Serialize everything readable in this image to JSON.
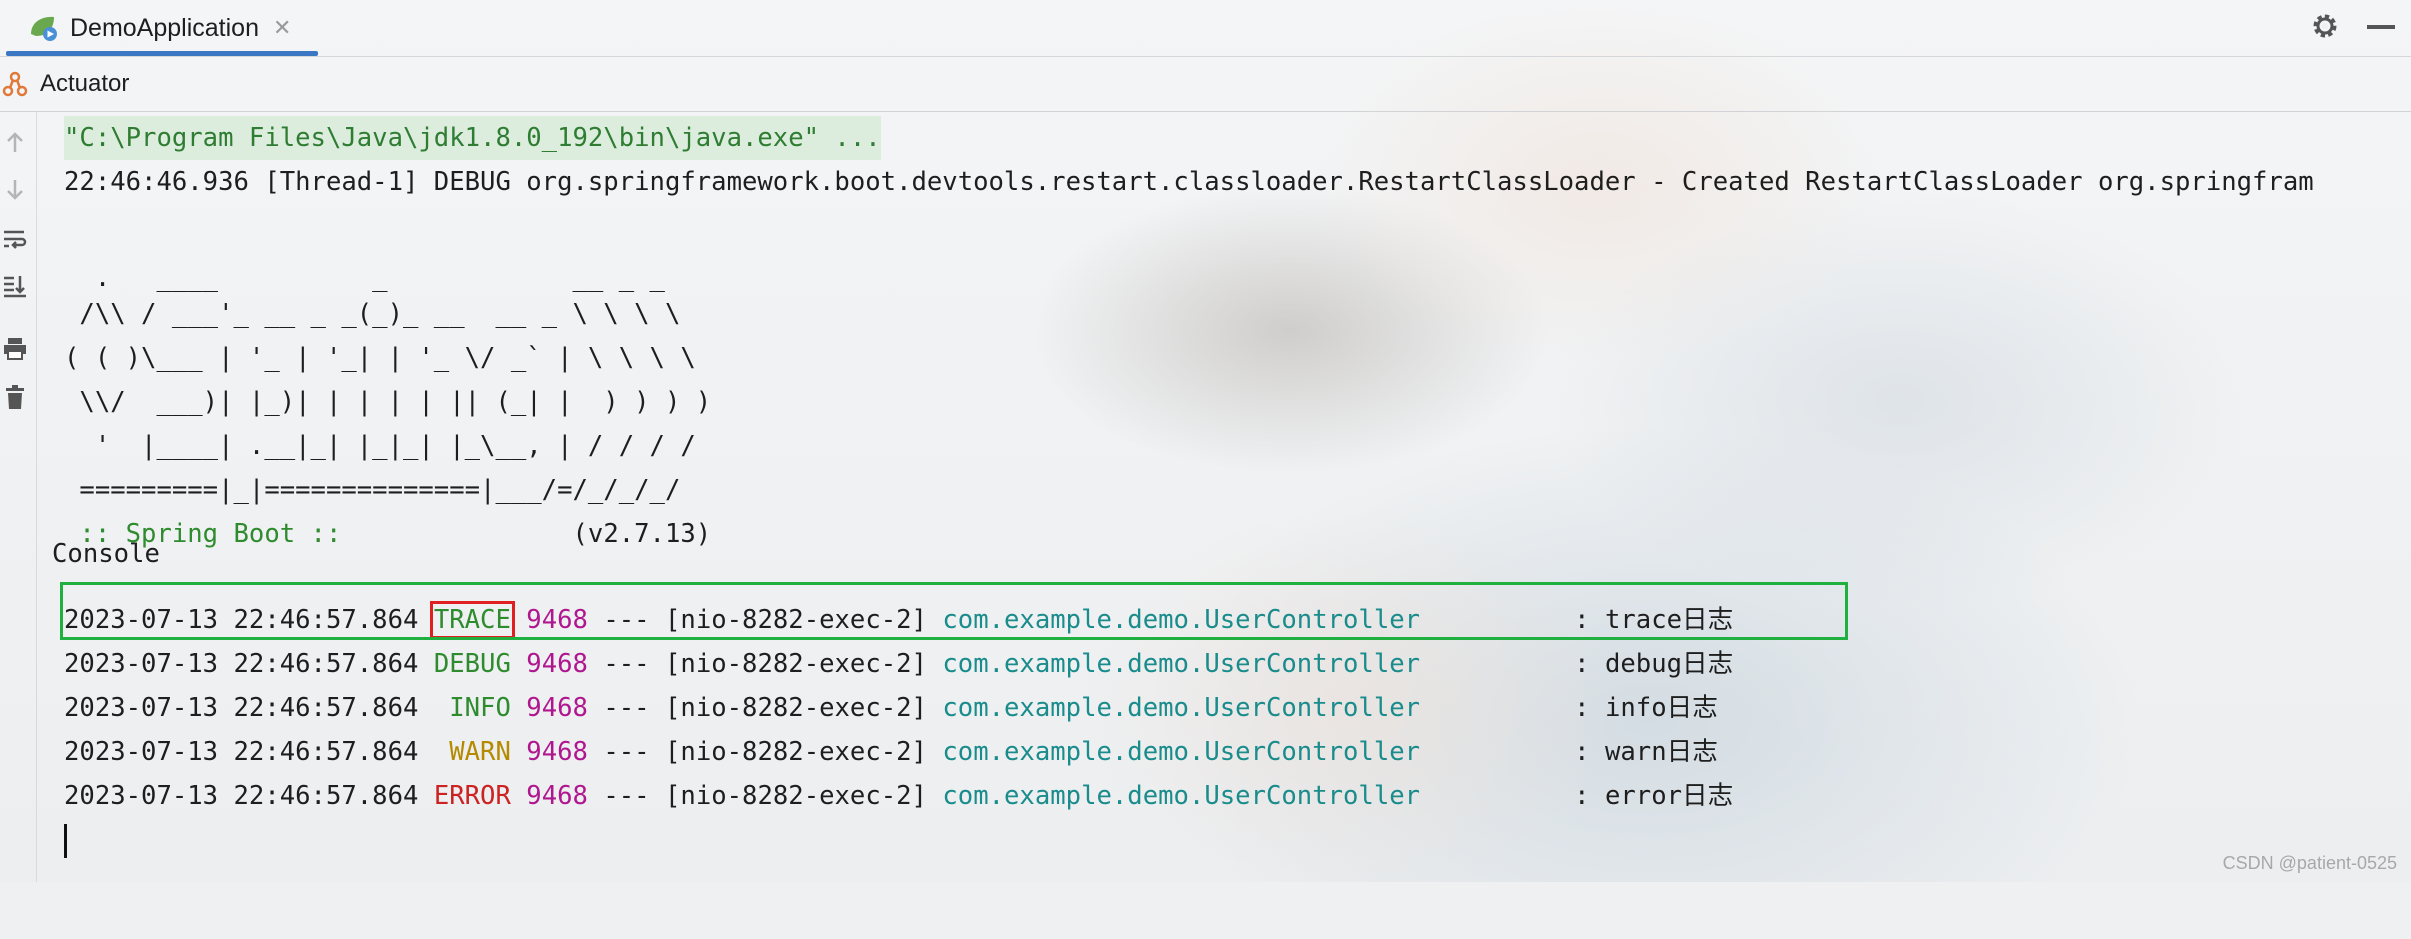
{
  "run_tab": {
    "name": "DemoApplication",
    "close": "✕"
  },
  "top_actions": {
    "settings_icon": "gear-icon",
    "minimize_icon": "minimize-icon"
  },
  "subtabs": [
    {
      "label": "Console",
      "icon": null
    },
    {
      "label": "Actuator",
      "icon": "actuator-icon"
    }
  ],
  "side_toolbar": [
    "arrow-up-icon",
    "arrow-down-icon",
    "soft-wrap-icon",
    "scroll-to-end-icon",
    "print-icon",
    "clear-icon"
  ],
  "console": {
    "command": "\"C:\\Program Files\\Java\\jdk1.8.0_192\\bin\\java.exe\" ...",
    "debug_line": "22:46:46.936 [Thread-1] DEBUG org.springframework.boot.devtools.restart.classloader.RestartClassLoader - Created RestartClassLoader org.springfram",
    "banner": [
      "  .   ____          _            __ _ _",
      " /\\\\ / ___'_ __ _ _(_)_ __  __ _ \\ \\ \\ \\",
      "( ( )\\___ | '_ | '_| | '_ \\/ _` | \\ \\ \\ \\",
      " \\\\/  ___)| |_)| | | | | || (_| |  ) ) ) )",
      "  '  |____| .__|_| |_|_| |_\\__, | / / / /",
      " =========|_|==============|___/=/_/_/_/"
    ],
    "spring_label": " :: Spring Boot :: ",
    "spring_version": "              (v2.7.13)",
    "log_lines": [
      {
        "timestamp": "2023-07-13 22:46:57.864",
        "level": "TRACE",
        "pid": "9468",
        "sep": "---",
        "thread": "[nio-8282-exec-2]",
        "logger": "com.example.demo.UserController",
        "message": ": trace日志"
      },
      {
        "timestamp": "2023-07-13 22:46:57.864",
        "level": "DEBUG",
        "pid": "9468",
        "sep": "---",
        "thread": "[nio-8282-exec-2]",
        "logger": "com.example.demo.UserController",
        "message": ": debug日志"
      },
      {
        "timestamp": "2023-07-13 22:46:57.864",
        "level": " INFO",
        "pid": "9468",
        "sep": "---",
        "thread": "[nio-8282-exec-2]",
        "logger": "com.example.demo.UserController",
        "message": ": info日志"
      },
      {
        "timestamp": "2023-07-13 22:46:57.864",
        "level": " WARN",
        "pid": "9468",
        "sep": "---",
        "thread": "[nio-8282-exec-2]",
        "logger": "com.example.demo.UserController",
        "message": ": warn日志"
      },
      {
        "timestamp": "2023-07-13 22:46:57.864",
        "level": "ERROR",
        "pid": "9468",
        "sep": "---",
        "thread": "[nio-8282-exec-2]",
        "logger": "com.example.demo.UserController",
        "message": ": error日志"
      }
    ]
  },
  "watermark": "CSDN @patient-0525",
  "colors": {
    "accent": "#3b78c4",
    "highlight_box": "#1fb040",
    "trace_box": "#e02020",
    "level_info": "#2e8b2e",
    "level_warn": "#b58a00",
    "level_error": "#cc2222",
    "pid": "#b0178f",
    "logger": "#1a8c8c"
  }
}
